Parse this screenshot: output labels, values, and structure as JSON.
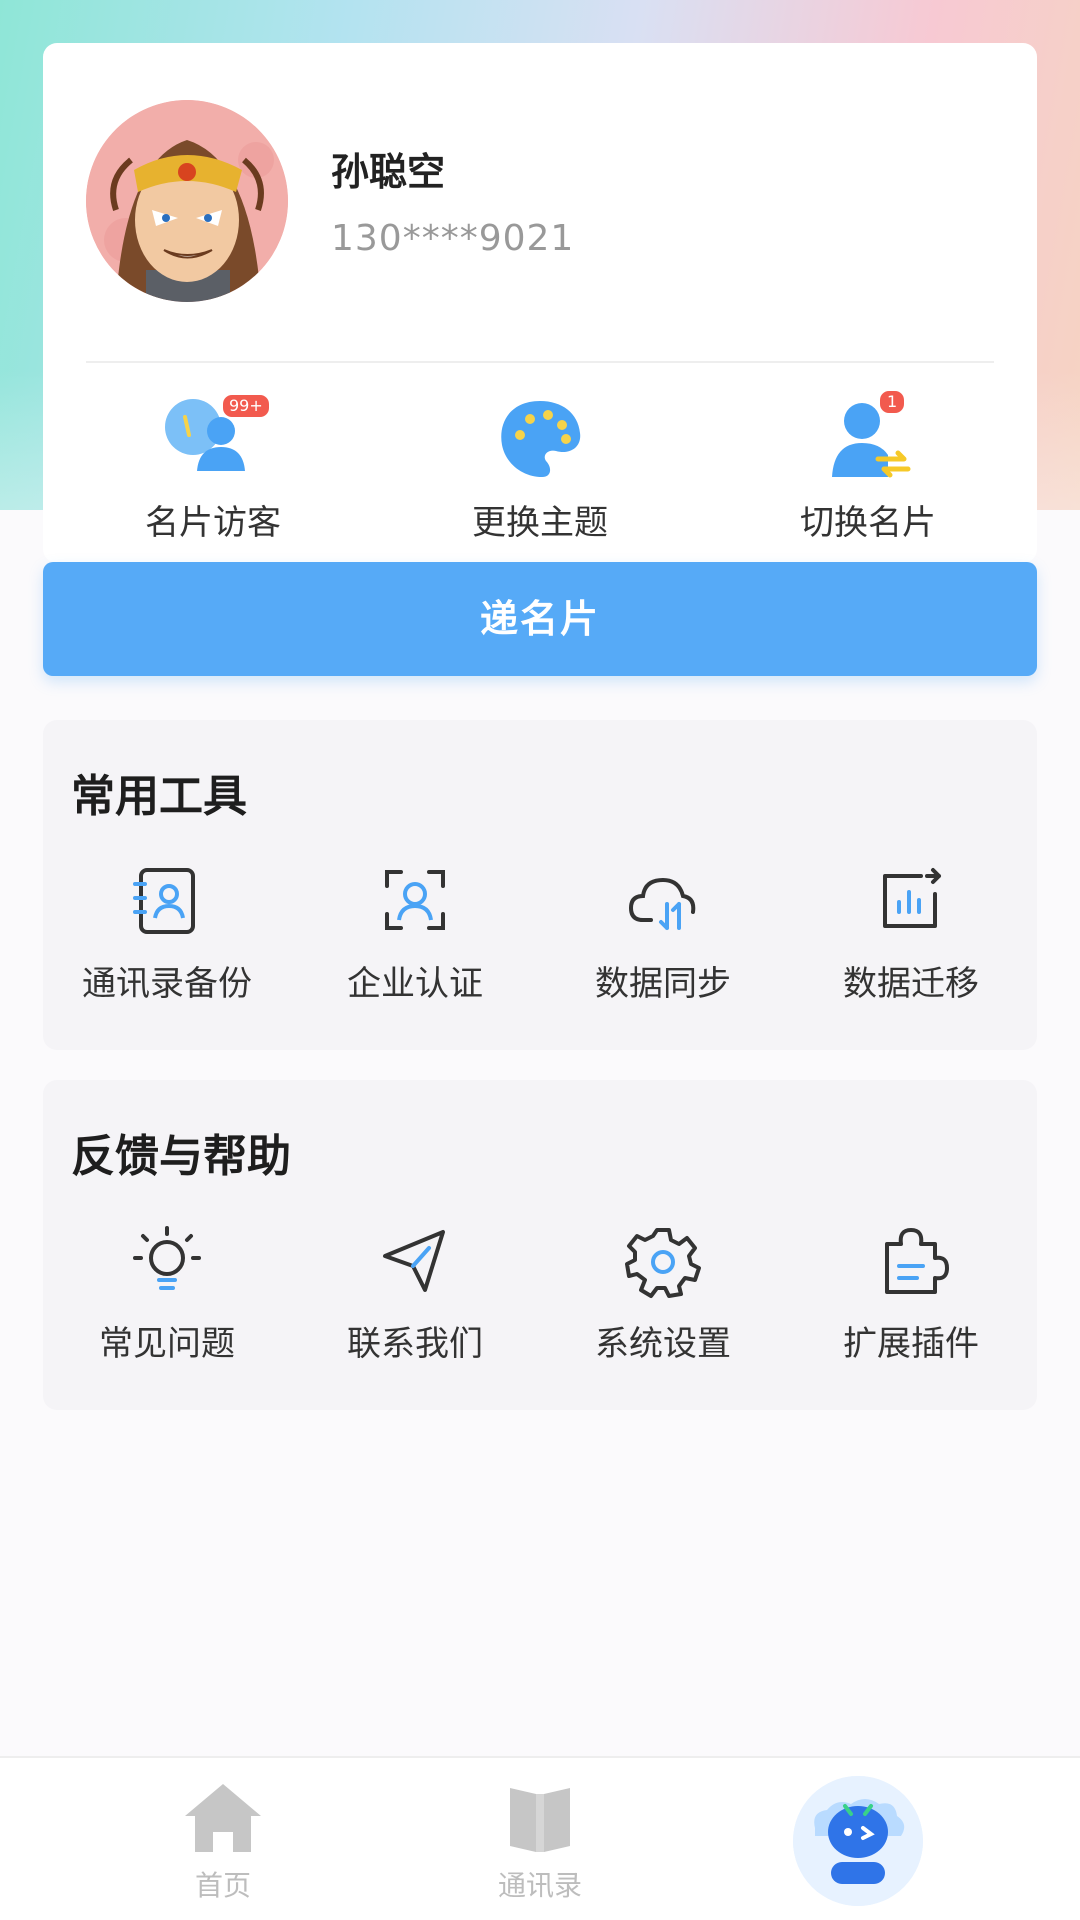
{
  "profile": {
    "name": "孙聪空",
    "phone": "130****9021"
  },
  "quick_actions": [
    {
      "label": "名片访客",
      "badge": "99+",
      "icon": "visitor-icon"
    },
    {
      "label": "更换主题",
      "icon": "palette-icon"
    },
    {
      "label": "切换名片",
      "badge": "1",
      "icon": "switch-card-icon"
    }
  ],
  "send_card_label": "递名片",
  "tools": {
    "title": "常用工具",
    "items": [
      {
        "label": "通讯录备份",
        "icon": "contact-backup-icon"
      },
      {
        "label": "企业认证",
        "icon": "enterprise-verify-icon"
      },
      {
        "label": "数据同步",
        "icon": "cloud-sync-icon"
      },
      {
        "label": "数据迁移",
        "icon": "data-migrate-icon"
      }
    ]
  },
  "help": {
    "title": "反馈与帮助",
    "items": [
      {
        "label": "常见问题",
        "icon": "lightbulb-icon"
      },
      {
        "label": "联系我们",
        "icon": "paper-plane-icon"
      },
      {
        "label": "系统设置",
        "icon": "gear-icon"
      },
      {
        "label": "扩展插件",
        "icon": "puzzle-icon"
      }
    ]
  },
  "tabbar": {
    "home": "首页",
    "contacts": "通讯录"
  },
  "colors": {
    "accent": "#56aaf7",
    "badge": "#f25a4e",
    "icon_blue": "#4aa3f5"
  }
}
